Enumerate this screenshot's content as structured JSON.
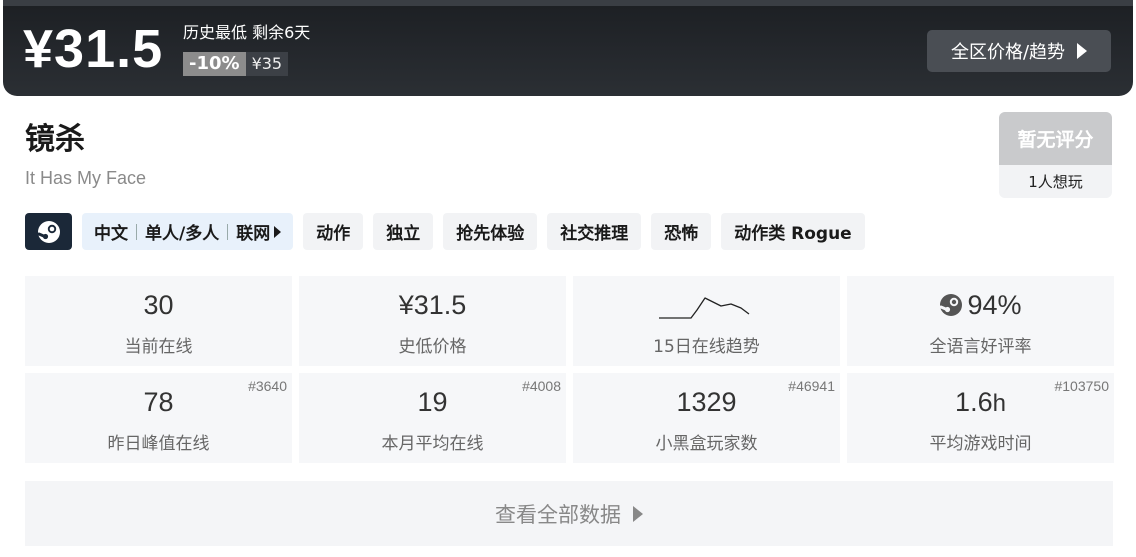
{
  "price_bar": {
    "current_price": "¥31.5",
    "note": "历史最低 剩余6天",
    "discount": "-10%",
    "original_price": "¥35",
    "region_button": "全区价格/趋势"
  },
  "game": {
    "title": "镜杀",
    "subtitle": "It Has My Face"
  },
  "score": {
    "rating": "暂无评分",
    "wishlist": "1人想玩"
  },
  "tags": {
    "platform_icon": "steam-icon",
    "lang_parts": [
      "中文",
      "单人/多人",
      "联网"
    ],
    "genres": [
      "动作",
      "独立",
      "抢先体验",
      "社交推理",
      "恐怖",
      "动作类 Rogue"
    ]
  },
  "stats": [
    {
      "value": "30",
      "label": "当前在线",
      "rank": ""
    },
    {
      "value": "¥31.5",
      "label": "史低价格",
      "rank": ""
    },
    {
      "value": "",
      "label": "15日在线趋势",
      "rank": ""
    },
    {
      "value": "94%",
      "label": "全语言好评率",
      "rank": ""
    },
    {
      "value": "78",
      "label": "昨日峰值在线",
      "rank": "#3640"
    },
    {
      "value": "19",
      "label": "本月平均在线",
      "rank": "#4008"
    },
    {
      "value": "1329",
      "label": "小黑盒玩家数",
      "rank": "#46941"
    },
    {
      "value": "1.6",
      "unit": "h",
      "label": "平均游戏时间",
      "rank": "#103750"
    }
  ],
  "view_all": "查看全部数据",
  "colors": {
    "price_bar_bg": "#23272c",
    "discount_bg": "#8c8c8c",
    "lang_tag_bg": "#e8f1fb",
    "cell_bg": "#f6f7f9"
  }
}
